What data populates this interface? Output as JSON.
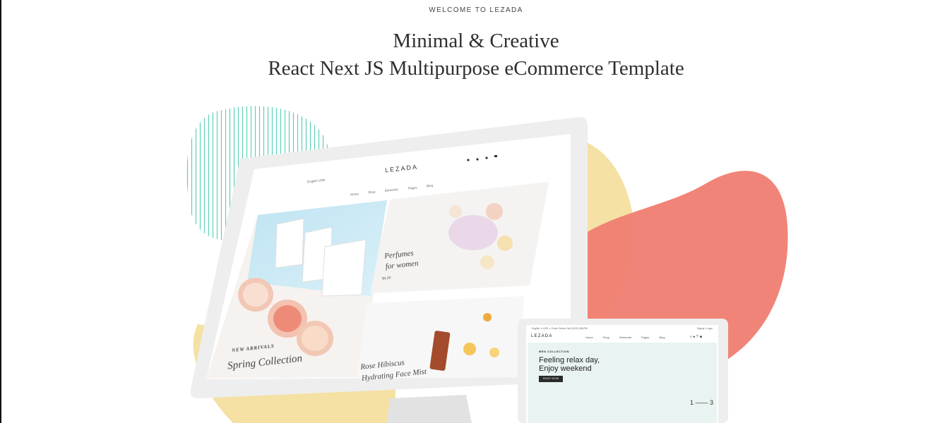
{
  "header": {
    "eyebrow": "WELCOME TO LEZADA",
    "title_line1": "Minimal & Creative",
    "title_line2": "React Next JS Multipurpose eCommerce Template"
  },
  "colors": {
    "coral": "#f07f72",
    "sand": "#f5e1a4",
    "teal_stripes": "#5fcfb8",
    "monitor_frame": "#ececec"
  },
  "desktop_mockup": {
    "logo": "LEZADA",
    "nav": [
      "Home",
      "Shop",
      "Elements",
      "Pages",
      "Blog"
    ],
    "topbar": "English  USD",
    "slide_eyebrow": "NEW ARRIVALS",
    "slide_title": "Spring Collection",
    "banner1_line1": "Perfumes",
    "banner1_line2": "for women",
    "banner1_price": "$4.20",
    "banner2_line1": "Rose Hibiscus",
    "banner2_line2": "Hydrating Face Mist"
  },
  "laptop_mockup": {
    "topbar_left": "English ∨   USD ∨    Order Online Call (0123) 456789",
    "topbar_right": "Signup / Login",
    "logo": "LEZADA",
    "nav": [
      "Home",
      "Shop",
      "Elements",
      "Pages",
      "Blog"
    ],
    "hero_eyebrow": "MEN COLLECTION",
    "hero_line1": "Feeling relax day,",
    "hero_line2": "Enjoy weekend",
    "hero_button": "SHOP NOW",
    "pager": "1 —— 3"
  }
}
